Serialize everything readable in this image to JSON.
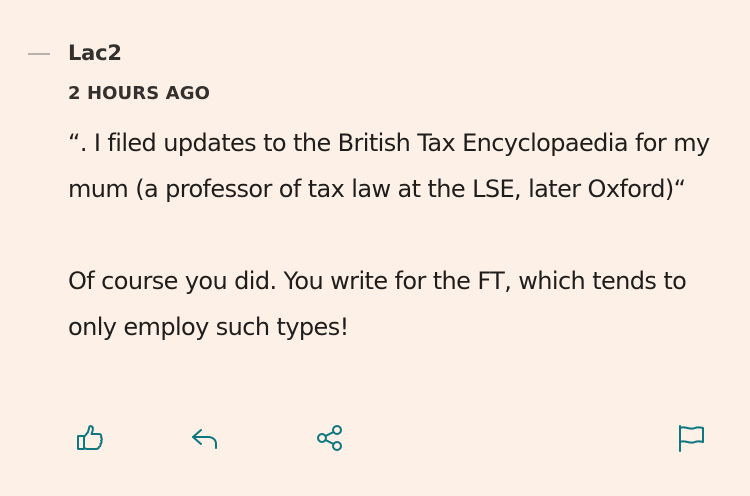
{
  "comment": {
    "author": "Lac2",
    "time": "2 HOURS AGO",
    "paragraphs": [
      "“. I filed updates to the British Tax Encyclopaedia for my mum (a professor of tax law at the LSE, later Oxford)“",
      "Of course you did. You write for the FT, which tends to only employ such types!"
    ],
    "actions": {
      "like_icon": "thumbs-up-icon",
      "reply_icon": "reply-arrow-icon",
      "share_icon": "share-icon",
      "report_icon": "flag-icon"
    },
    "colors": {
      "background": "#fdf0e6",
      "accent": "#0d7680",
      "text": "#33302e"
    }
  }
}
